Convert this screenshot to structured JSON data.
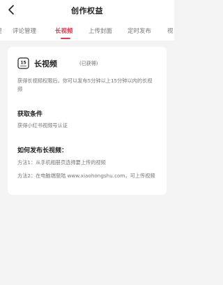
{
  "header": {
    "title": "创作权益"
  },
  "tabs": [
    {
      "label": "评论管理"
    },
    {
      "label": "长视频"
    },
    {
      "label": "上传封面"
    },
    {
      "label": "定时发布"
    },
    {
      "label": "视"
    }
  ],
  "active_tab_index": 1,
  "card": {
    "icon_text": "15",
    "title": "长视频",
    "status": "(已获得)",
    "description": "获得长视频权限后，你可以发布5分钟以上15分钟以内的长视频",
    "conditions_title": "获取条件",
    "conditions_text": "获得小红书视频号认证",
    "howto_title": "如何发布长视频：",
    "method1": "方法1：从手机相册页选择要上传的视频",
    "method2": "方法2：在电脑端登陆 www.xiaohongshu.com，可上传视频"
  },
  "colors": {
    "accent": "#e8384f",
    "background": "#f4f4f4"
  }
}
